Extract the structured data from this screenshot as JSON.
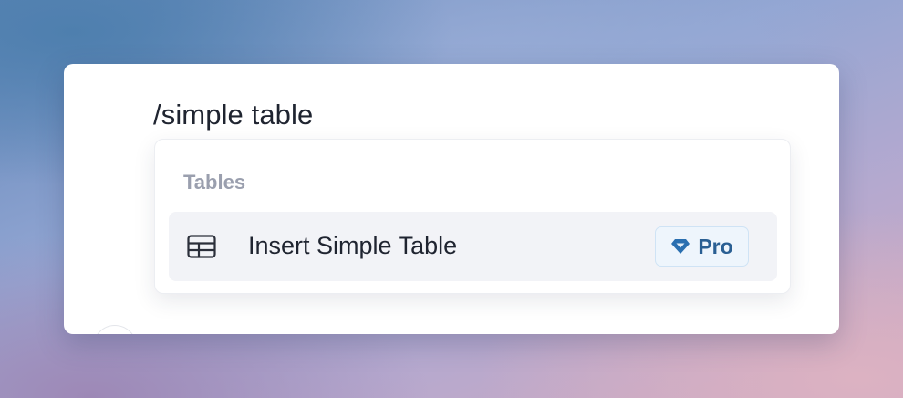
{
  "editor": {
    "command_text": "/simple table"
  },
  "menu": {
    "section_heading": "Tables",
    "items": [
      {
        "label": "Insert Simple Table",
        "icon": "table-icon",
        "badge": {
          "label": "Pro",
          "icon": "diamond-icon",
          "color": "#2a5f93"
        }
      }
    ]
  }
}
